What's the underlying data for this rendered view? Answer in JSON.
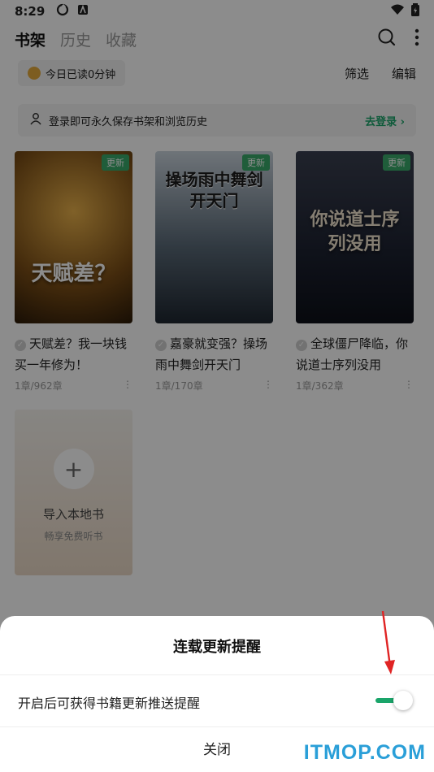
{
  "status": {
    "time": "8:29"
  },
  "tabs": [
    {
      "label": "书架"
    },
    {
      "label": "历史"
    },
    {
      "label": "收藏"
    }
  ],
  "reading": {
    "today": "今日已读0分钟"
  },
  "filters": {
    "filter": "筛选",
    "edit": "编辑"
  },
  "login": {
    "hint": "登录即可永久保存书架和浏览历史",
    "action": "去登录"
  },
  "books": [
    {
      "cover_title": "天赋差？",
      "badge": "更新",
      "title": "天赋差？我一块钱买一年修为！",
      "progress": "1章/962章",
      "cover_color": "#6b4d1c"
    },
    {
      "cover_title": "操场雨中舞剑开天门",
      "badge": "更新",
      "title": "嘉豪就变强？操场雨中舞剑开天门",
      "progress": "1章/170章",
      "cover_color": "#3c4a5a"
    },
    {
      "cover_title": "你说道士序列没用",
      "badge": "更新",
      "title": "全球僵尸降临，你说道士序列没用",
      "progress": "1章/362章",
      "cover_color": "#2a2f3b"
    }
  ],
  "import_card": {
    "label": "导入本地书",
    "sub": "畅享免费听书"
  },
  "sheet": {
    "title": "连载更新提醒",
    "setting_label": "开启后可获得书籍更新推送提醒",
    "toggle_on": true,
    "close": "关闭"
  },
  "watermark": "ITMOP.COM",
  "colors": {
    "accent": "#1aa56a",
    "badge": "#39a96b",
    "arrow": "#e02424",
    "watermark": "#2a9fd8"
  }
}
